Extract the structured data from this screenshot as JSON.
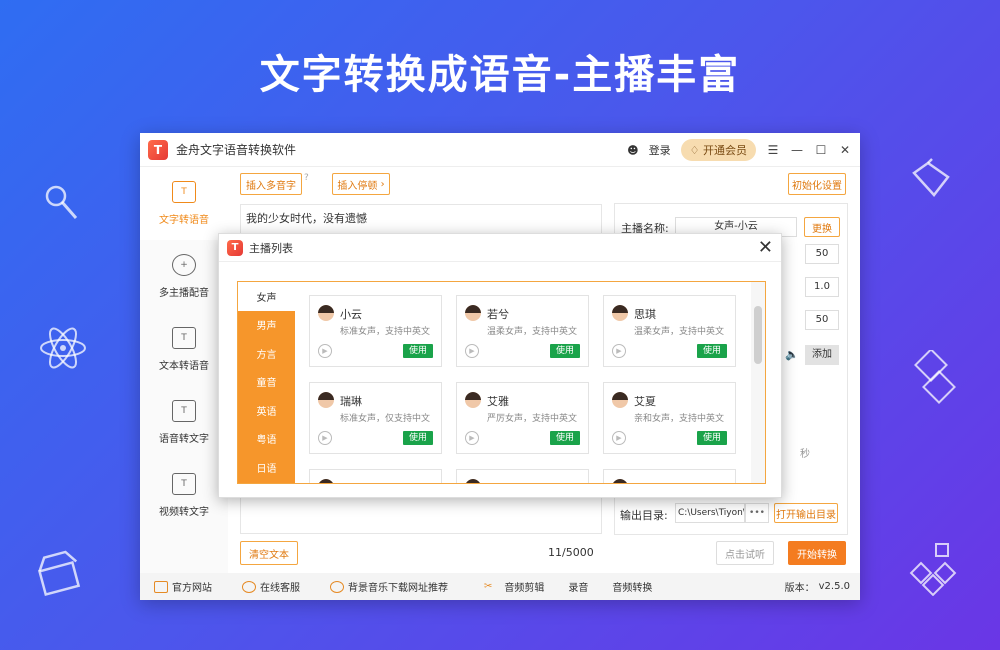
{
  "banner": {
    "title": "文字转换成语音-主播丰富"
  },
  "app": {
    "title": "金舟文字语音转换软件",
    "login": "登录",
    "vip": "开通会员",
    "version_label": "版本：",
    "version": "v2.5.0"
  },
  "sidebar": {
    "items": [
      {
        "label": "文字转语音",
        "icon": "T"
      },
      {
        "label": "多主播配音",
        "icon": "+"
      },
      {
        "label": "文本转语音",
        "icon": "T"
      },
      {
        "label": "语音转文字",
        "icon": "T"
      },
      {
        "label": "视频转文字",
        "icon": "T"
      }
    ]
  },
  "editor": {
    "insert_polyphone": "插入多音字",
    "insert_pause": "插入停顿",
    "text": "我的少女时代，没有遗憾",
    "clear": "清空文本",
    "counter": "11/5000"
  },
  "settings": {
    "reset": "初始化设置",
    "anchor_label": "主播名称:",
    "anchor_value": "女声-小云",
    "change": "更换",
    "num1": "50",
    "num2": "1.0",
    "num3": "50",
    "add": "添加",
    "seconds": "秒",
    "output_label": "输出目录:",
    "output_path": "C:\\Users\\Tiyon\\",
    "browse": "•••",
    "open_output": "打开输出目录",
    "preview": "点击试听",
    "start": "开始转换"
  },
  "bottom": {
    "website": "官方网站",
    "service": "在线客服",
    "music": "背景音乐下载网址推荐",
    "audio_cut": "音频剪辑",
    "record": "录音",
    "audio_convert": "音频转换"
  },
  "dialog": {
    "title": "主播列表",
    "categories": [
      "女声",
      "男声",
      "方言",
      "童音",
      "英语",
      "粤语",
      "日语"
    ],
    "use_label": "使用",
    "anchors": [
      {
        "name": "小云",
        "desc": "标准女声，支持中英文"
      },
      {
        "name": "若兮",
        "desc": "温柔女声，支持中英文"
      },
      {
        "name": "思琪",
        "desc": "温柔女声，支持中英文"
      },
      {
        "name": "瑞琳",
        "desc": "标准女声，仅支持中文"
      },
      {
        "name": "艾雅",
        "desc": "严厉女声，支持中英文"
      },
      {
        "name": "艾夏",
        "desc": "亲和女声，支持中英文"
      }
    ]
  }
}
